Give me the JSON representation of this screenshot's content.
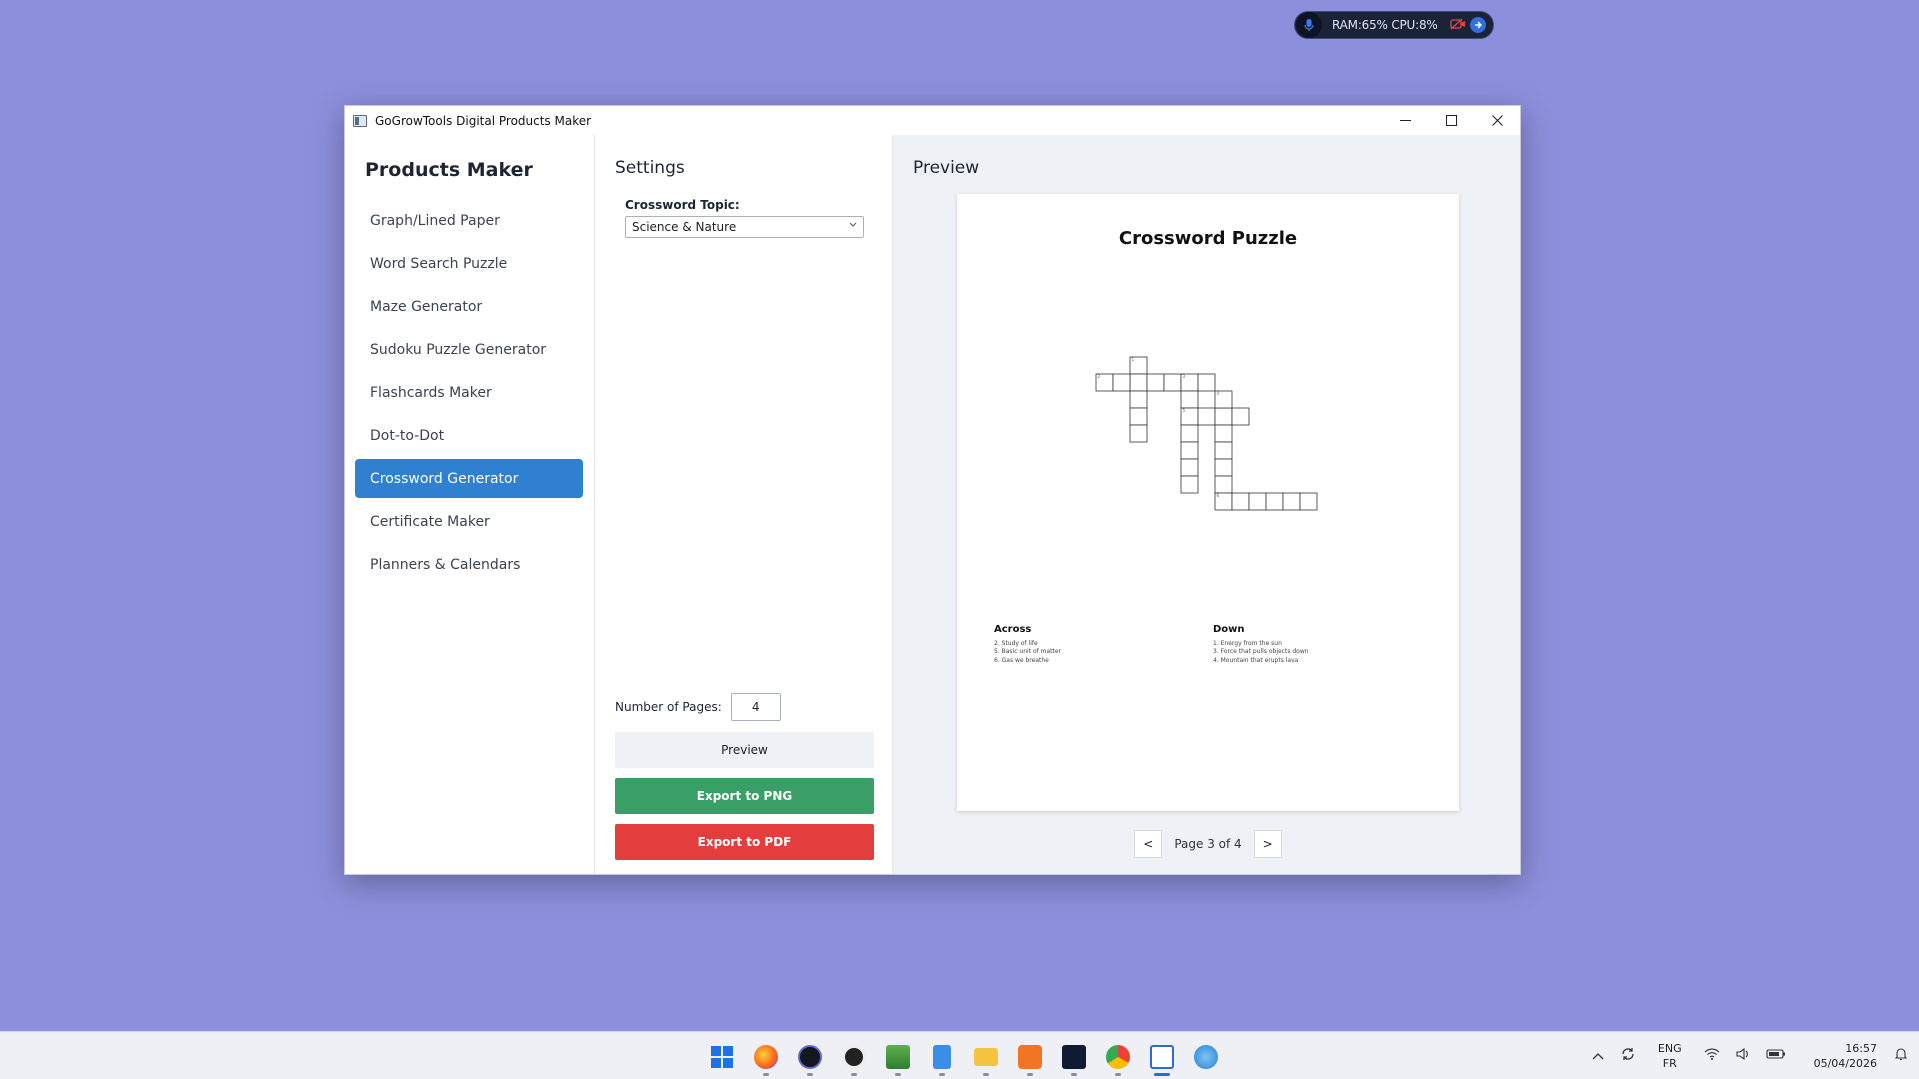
{
  "monitor": {
    "text": "RAM:65%   CPU:8%"
  },
  "window": {
    "title": "GoGrowTools Digital Products Maker"
  },
  "sidebar": {
    "title": "Products Maker",
    "items": [
      {
        "label": "Graph/Lined Paper"
      },
      {
        "label": "Word Search Puzzle"
      },
      {
        "label": "Maze Generator"
      },
      {
        "label": "Sudoku Puzzle Generator"
      },
      {
        "label": "Flashcards Maker"
      },
      {
        "label": "Dot-to-Dot"
      },
      {
        "label": "Crossword Generator",
        "active": true
      },
      {
        "label": "Certificate Maker"
      },
      {
        "label": "Planners & Calendars"
      }
    ]
  },
  "settings": {
    "title": "Settings",
    "topic_label": "Crossword Topic:",
    "topic_value": "Science & Nature",
    "pages_label": "Number of Pages:",
    "pages_value": "4",
    "preview_btn": "Preview",
    "png_btn": "Export to PNG",
    "pdf_btn": "Export to PDF"
  },
  "preview": {
    "title": "Preview",
    "page_title": "Crossword Puzzle",
    "across_heading": "Across",
    "across": [
      "2. Study of life",
      "5. Basic unit of matter",
      "6. Gas we breathe"
    ],
    "down_heading": "Down",
    "down": [
      "1. Energy from the sun",
      "3. Force that pulls objects down",
      "4. Mountain that erupts lava"
    ],
    "pager_prev": "<",
    "pager_label": "Page 3 of 4",
    "pager_next": ">"
  },
  "taskbar": {
    "lang_top": "ENG",
    "lang_bottom": "FR",
    "time": "16:57",
    "date": "05/04/2026"
  },
  "colors": {
    "accent": "#2f80d1",
    "export_png": "#38a067",
    "export_pdf": "#e43d3d",
    "desktop": "#8c8fdb"
  }
}
